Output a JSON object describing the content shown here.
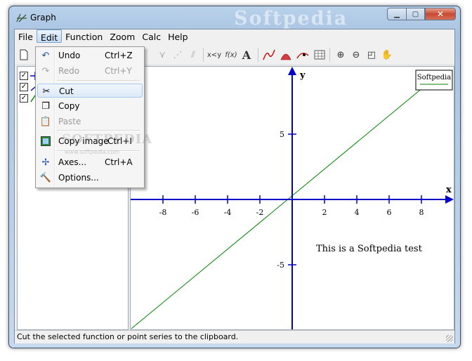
{
  "window": {
    "title": "Graph",
    "watermark": "Softpedia"
  },
  "menubar": [
    "File",
    "Edit",
    "Function",
    "Zoom",
    "Calc",
    "Help"
  ],
  "toolbar_icons": [
    "new-icon",
    "open-icon",
    "save-icon",
    "print-icon",
    "insert-function-icon",
    "insert-tangent-icon",
    "insert-shading-icon",
    "insert-point-series-icon",
    "insert-trendline-icon",
    "insert-relation-icon",
    "insert-label-icon",
    "calc-table-icon",
    "zoom-in-icon",
    "zoom-out-icon",
    "zoom-square-icon",
    "move-hand-icon"
  ],
  "toolbar_text": {
    "xy": "x<y",
    "fx": "f(x)",
    "A": "A"
  },
  "tree": {
    "items": [
      {
        "checked": true,
        "icon": "axes-icon"
      },
      {
        "checked": true,
        "icon": "function-icon"
      },
      {
        "checked": true,
        "icon": "line-icon"
      }
    ]
  },
  "edit_menu": {
    "items": [
      {
        "label": "Undo",
        "shortcut": "Ctrl+Z",
        "icon": "undo-icon",
        "enabled": true
      },
      {
        "label": "Redo",
        "shortcut": "Ctrl+Y",
        "icon": "redo-icon",
        "enabled": false
      },
      {
        "label": "Cut",
        "shortcut": "",
        "icon": "scissors-icon",
        "enabled": true,
        "highlighted": true
      },
      {
        "label": "Copy",
        "shortcut": "",
        "icon": "copy-icon",
        "enabled": true
      },
      {
        "label": "Paste",
        "shortcut": "",
        "icon": "paste-icon",
        "enabled": false
      },
      {
        "label": "Copy image",
        "shortcut": "Ctrl+I",
        "icon": "image-icon",
        "enabled": true
      },
      {
        "label": "Axes...",
        "shortcut": "Ctrl+A",
        "icon": "axes-icon",
        "enabled": true
      },
      {
        "label": "Options...",
        "shortcut": "",
        "icon": "hammer-icon",
        "enabled": true
      }
    ],
    "watermark": "SOFTPEDIA",
    "watermark_url": "www.softpedia.com"
  },
  "graph": {
    "x_axis_label": "x",
    "y_axis_label": "y",
    "x_ticks": [
      "-8",
      "-6",
      "-4",
      "-2",
      "2",
      "4",
      "6",
      "8"
    ],
    "y_ticks": [
      "5",
      "-5"
    ],
    "legend": "Softpedia",
    "annotation": "This is a Softpedia test",
    "function_color": "#008000",
    "axis_color": "#0000cc"
  },
  "statusbar": {
    "text": "Cut the selected function or point series to the clipboard."
  }
}
